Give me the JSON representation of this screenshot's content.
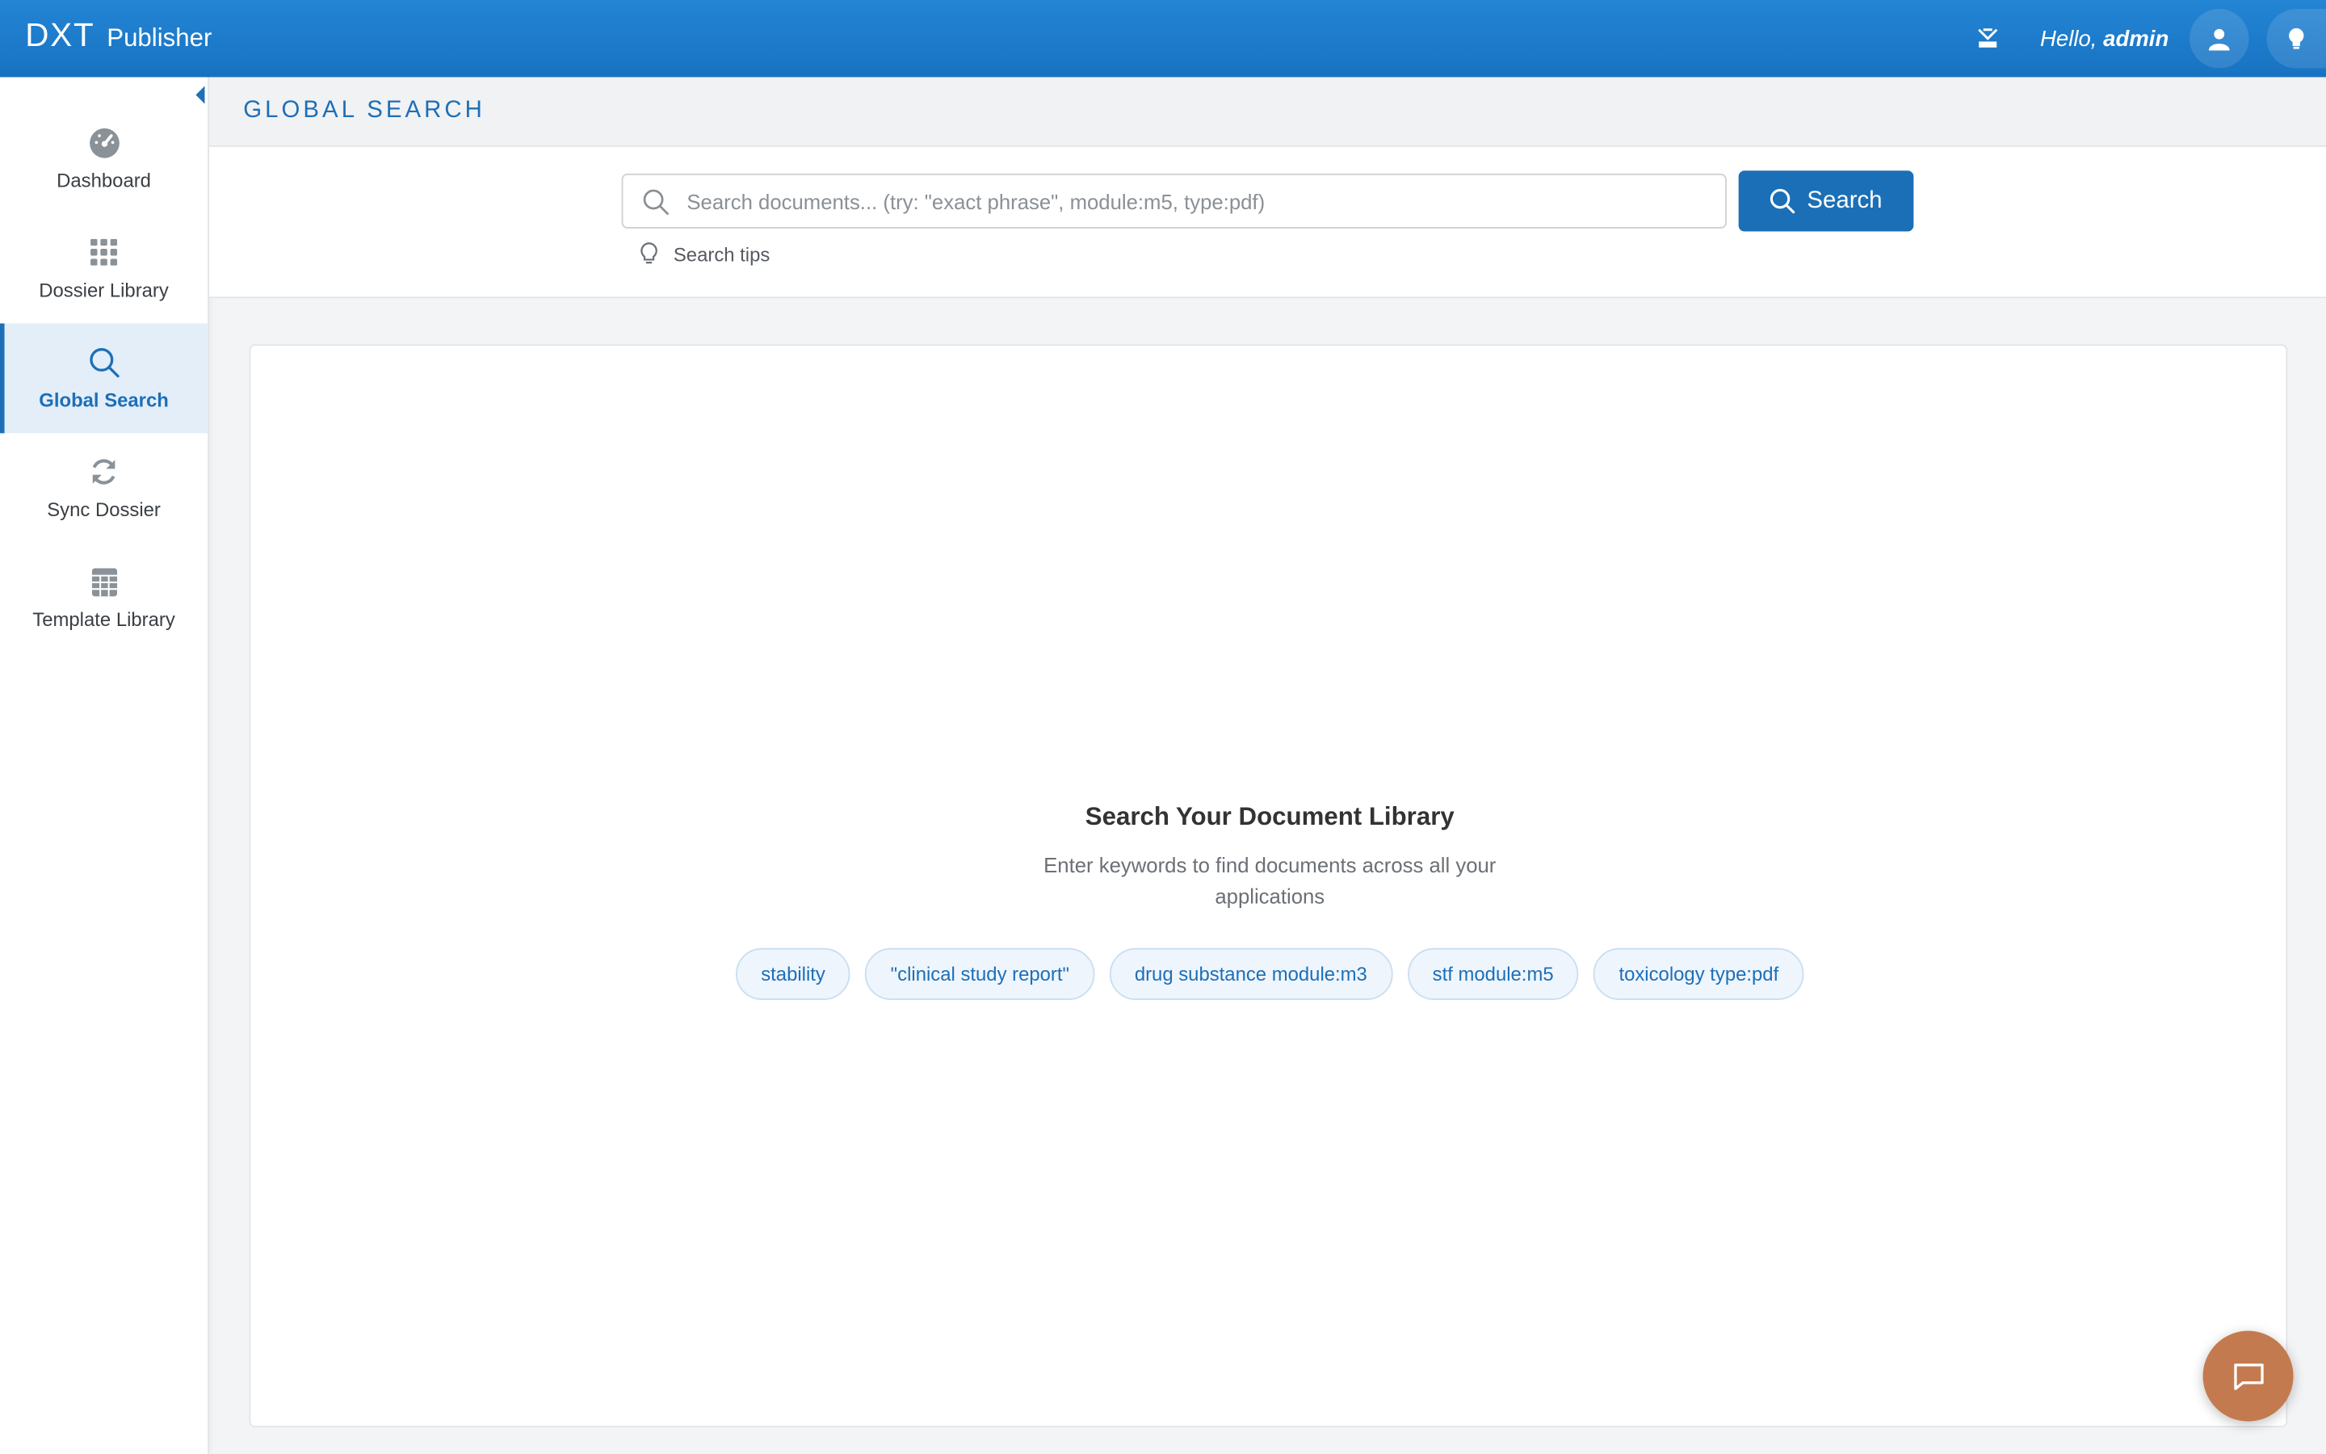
{
  "app": {
    "logo_mark": "DXT",
    "logo_text": "Publisher"
  },
  "topbar": {
    "greeting": "Hello,",
    "username": "admin"
  },
  "sidebar": {
    "items": [
      {
        "label": "Dashboard",
        "icon": "dashboard-gauge-icon"
      },
      {
        "label": "Dossier Library",
        "icon": "grid-icon"
      },
      {
        "label": "Global Search",
        "icon": "search-icon",
        "active": true
      },
      {
        "label": "Sync Dossier",
        "icon": "sync-icon"
      },
      {
        "label": "Template Library",
        "icon": "table-icon"
      }
    ]
  },
  "page": {
    "title": "GLOBAL SEARCH"
  },
  "search": {
    "placeholder": "Search documents... (try: \"exact phrase\", module:m5, type:pdf)",
    "value": "",
    "button_label": "Search",
    "tips_label": "Search tips"
  },
  "empty_state": {
    "title": "Search Your Document Library",
    "description": "Enter keywords to find documents across all your applications",
    "suggestions": [
      "stability",
      "\"clinical study report\"",
      "drug substance module:m3",
      "stf module:m5",
      "toxicology type:pdf"
    ]
  },
  "colors": {
    "topbar": "#1e7cc9",
    "accent": "#1d6fb8",
    "chat_button": "#c47a4f"
  }
}
